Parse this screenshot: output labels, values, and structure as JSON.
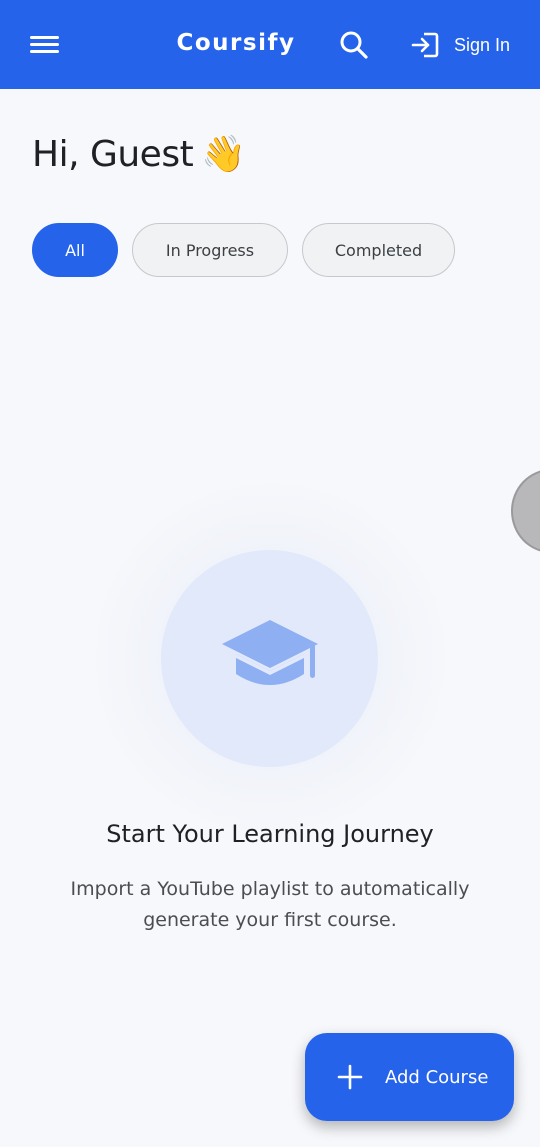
{
  "app_bar": {
    "brand": "Coursify",
    "menu_icon": "hamburger-menu-icon",
    "search_icon": "search-icon",
    "signin_icon": "login-arrow-icon",
    "signin_label": "Sign In",
    "background_color": "#2563eb"
  },
  "greeting": {
    "text": "Hi, Guest",
    "emoji": "👋"
  },
  "filters": {
    "chips": [
      {
        "label": "All",
        "active": true
      },
      {
        "label": "In Progress",
        "active": false
      },
      {
        "label": "Completed",
        "active": false
      }
    ]
  },
  "empty_state": {
    "icon": "graduation-cap-icon",
    "title": "Start Your Learning Journey",
    "description": "Import a YouTube playlist to automatically generate your first course."
  },
  "fab": {
    "icon": "plus-icon",
    "label": "Add Course"
  },
  "colors": {
    "primary": "#2563eb",
    "background": "#f7f8fb",
    "icon_tint": "#8eb0f2",
    "circle_fill": "#e1e9fb"
  }
}
